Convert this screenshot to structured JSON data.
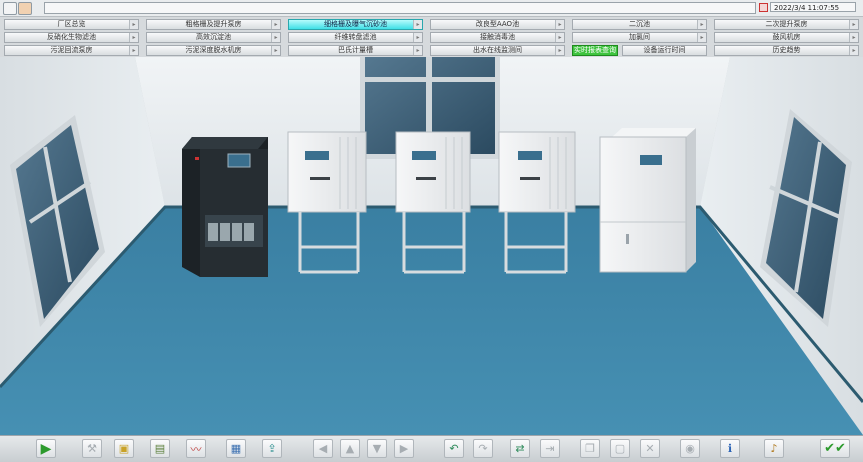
{
  "clock": "2022/3/4 11:07:55",
  "nav": {
    "row1": [
      "厂区总览",
      "粗格栅及提升泵房",
      "细格栅及曝气沉砂池",
      "改良型AAO池",
      "二沉池",
      "二次提升泵房"
    ],
    "row2": [
      "反硝化生物滤池",
      "高效沉淀池",
      "纤维转盘滤池",
      "接触消毒池",
      "加氯间",
      "鼓风机房"
    ],
    "row3": [
      "污泥回流泵房",
      "污泥深度脱水机房",
      "巴氏计量槽",
      "出水在线监测间",
      "实时报表查询",
      "设备运行时间",
      "历史趋势"
    ],
    "active": "细格栅及曝气沉砂池"
  },
  "toolbar": {
    "icons": [
      "play-icon",
      "tools-icon",
      "folder-icon",
      "report-icon",
      "trend-icon",
      "document-icon",
      "export-icon",
      "arrow-left-icon",
      "arrow-up-icon",
      "arrow-down-icon",
      "arrow-right-icon",
      "undo-icon",
      "redo-icon",
      "screen-switch-icon",
      "screen-next-icon",
      "copy-icon",
      "paste-icon",
      "delete-icon",
      "view-icon",
      "info-icon",
      "sound-icon",
      "confirm-icon"
    ]
  },
  "colors": {
    "floor": "#3f86a8",
    "wall": "#e5eaee",
    "active_button": "#3fdfe6",
    "report_button": "#3fc43f",
    "cabinet_dark": "#1c2226"
  }
}
